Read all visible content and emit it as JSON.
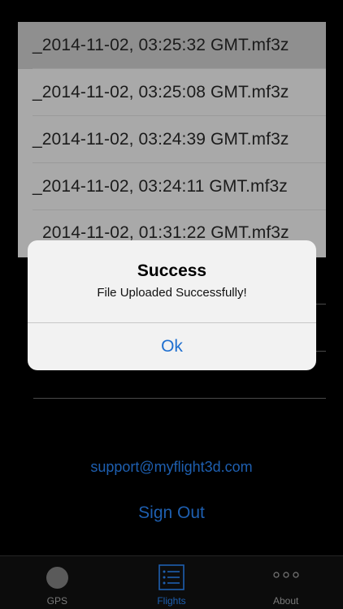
{
  "file_list": {
    "items": [
      {
        "label": "_2014-11-02, 03:25:32 GMT.mf3z"
      },
      {
        "label": "_2014-11-02, 03:25:08 GMT.mf3z"
      },
      {
        "label": "_2014-11-02, 03:24:39 GMT.mf3z"
      },
      {
        "label": "_2014-11-02, 03:24:11 GMT.mf3z"
      },
      {
        "label": "2014-11-02, 01:31:22 GMT.mf3z"
      }
    ]
  },
  "links": {
    "support": "support@myflight3d.com",
    "sign_out": "Sign Out"
  },
  "tabs": [
    {
      "label": "GPS",
      "icon": "gps-circle-icon"
    },
    {
      "label": "Flights",
      "icon": "list-icon",
      "active": true
    },
    {
      "label": "About",
      "icon": "more-dots-icon"
    }
  ],
  "alert": {
    "title": "Success",
    "message": "File Uploaded Successfully!",
    "ok_label": "Ok"
  },
  "colors": {
    "accent": "#1e5fb0",
    "alert_button": "#1e6fd0",
    "list_bg": "#a9a9a9"
  }
}
